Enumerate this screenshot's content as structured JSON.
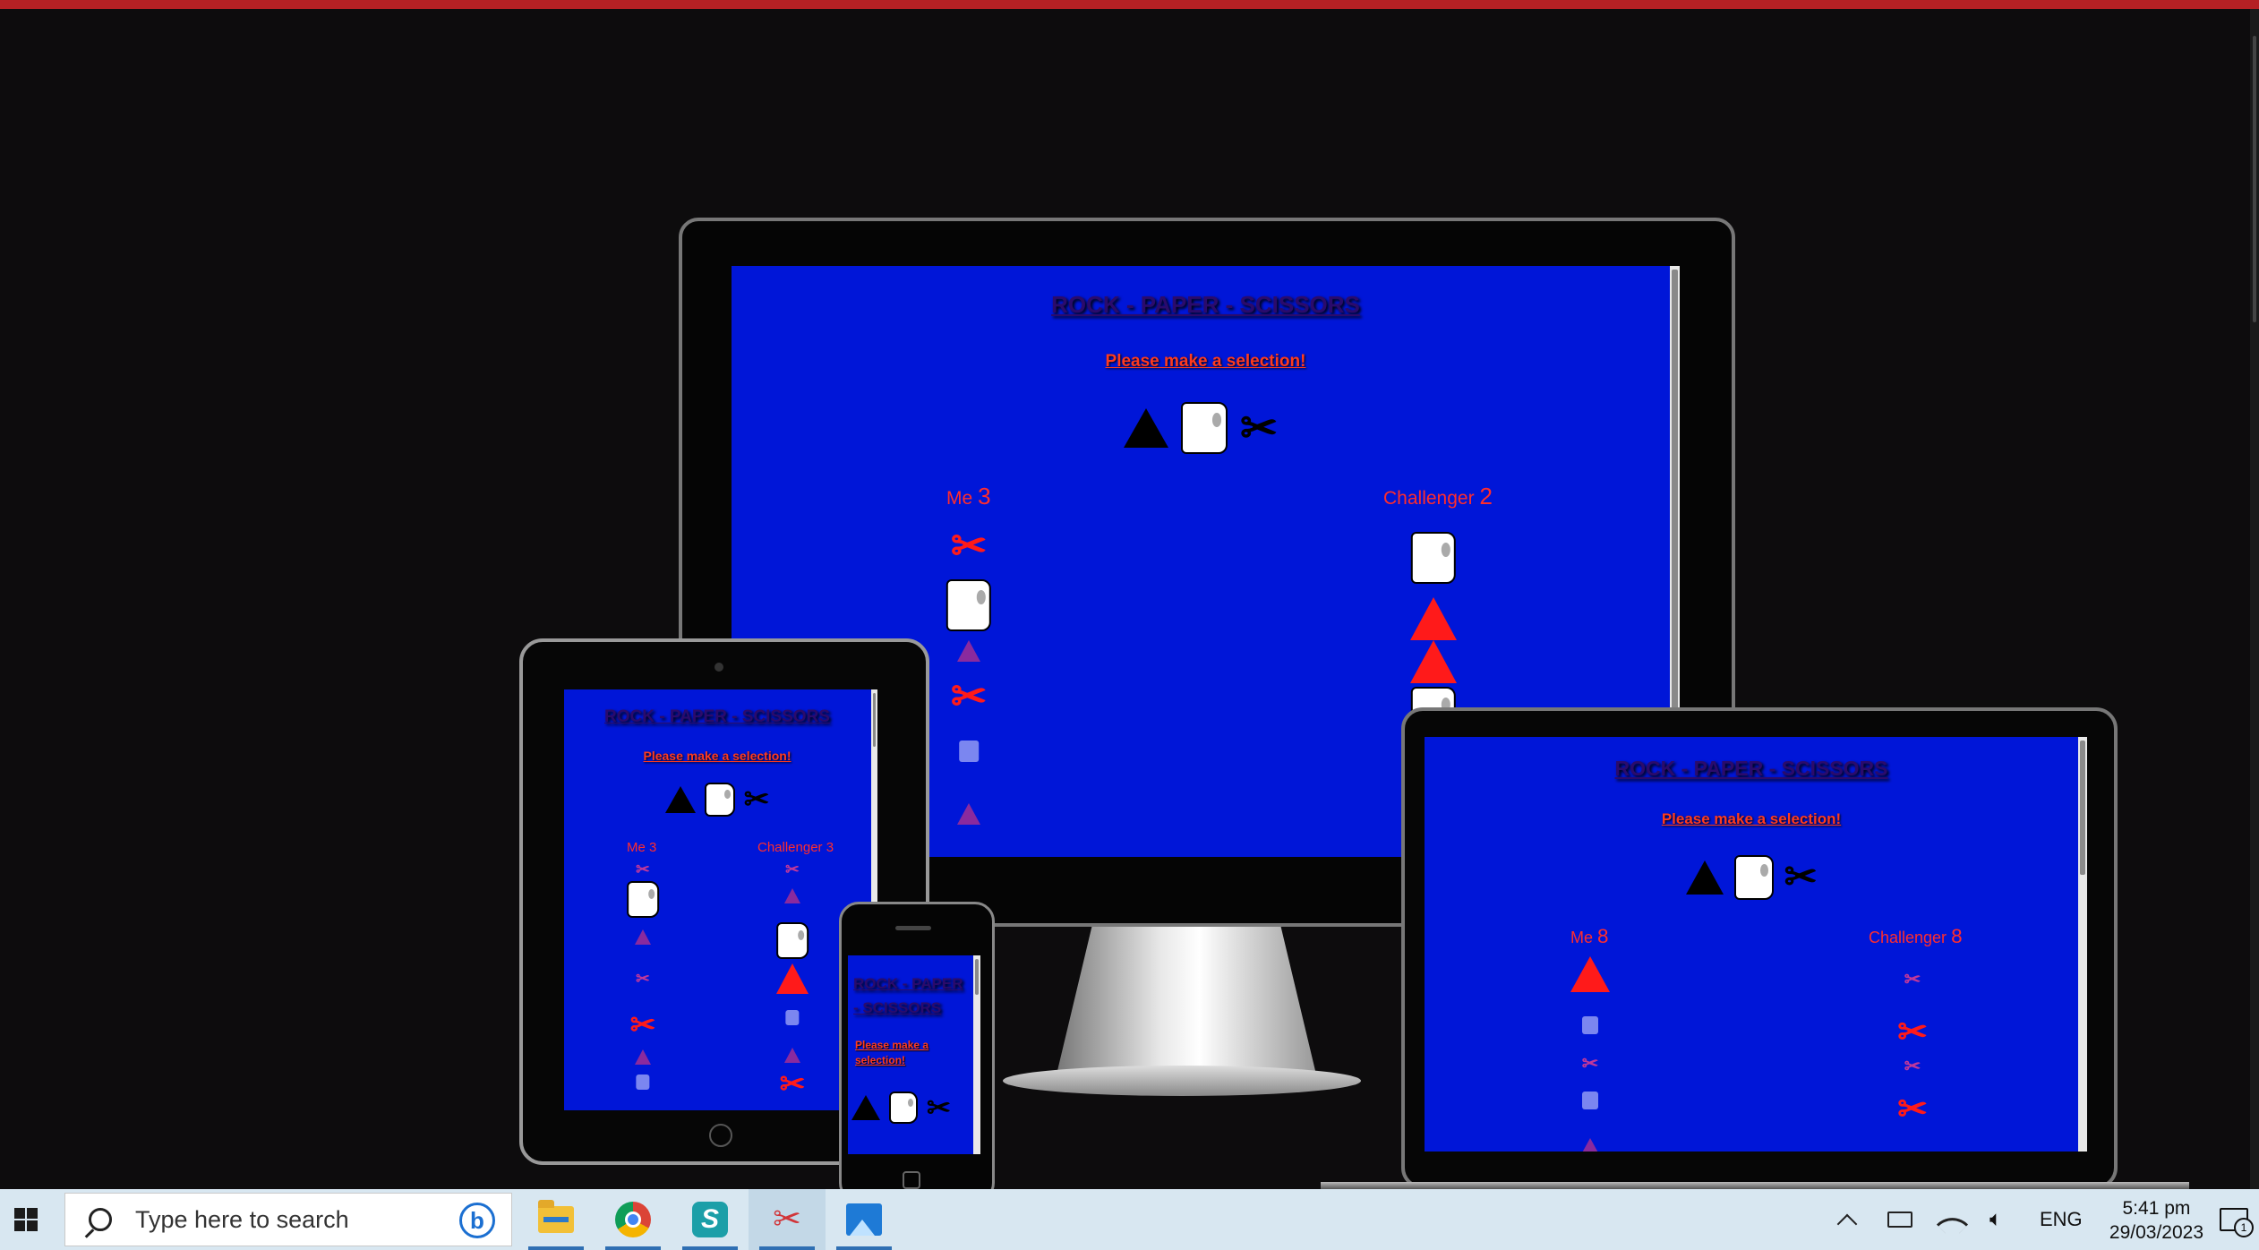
{
  "game": {
    "title": "ROCK - PAPER - SCISSORS",
    "prompt": "Please make a selection!",
    "choice_icons": [
      "rock-icon",
      "paper-icon",
      "scissors-icon"
    ]
  },
  "devices": {
    "desktop": {
      "player_label": "Me",
      "player_score": "3",
      "challenger_label": "Challenger",
      "challenger_score": "2",
      "player_history": [
        "scissors",
        "paper",
        "rock",
        "scissors",
        "paper",
        "rock"
      ],
      "challenger_history": [
        "paper",
        "rock",
        "rock",
        "paper"
      ]
    },
    "tablet": {
      "player_label": "Me",
      "player_score": "3",
      "challenger_label": "Challenger",
      "challenger_score": "3",
      "player_history": [
        "scissors",
        "paper",
        "rock",
        "scissors",
        "scissors",
        "rock",
        "paper"
      ],
      "challenger_history": [
        "scissors",
        "rock",
        "paper",
        "rock",
        "paper",
        "rock",
        "scissors"
      ]
    },
    "phone": {
      "title_line1": "ROCK - PAPER",
      "title_line2": "- SCISSORS",
      "prompt_line1": "Please make a",
      "prompt_line2": "selection!"
    },
    "laptop": {
      "player_label": "Me",
      "player_score": "8",
      "challenger_label": "Challenger",
      "challenger_score": "8",
      "player_history": [
        "rock",
        "paper",
        "scissors",
        "paper",
        "rock"
      ],
      "challenger_history": [
        "scissors",
        "scissors",
        "scissors",
        "scissors"
      ]
    }
  },
  "colors": {
    "screen_bg": "#0016d8",
    "score_red": "#ff2d2d",
    "title_text": "#2b0b6b",
    "top_bar": "#b52024"
  },
  "taskbar": {
    "search_placeholder": "Type here to search",
    "apps": [
      "file-explorer-icon",
      "chrome-icon",
      "s-app-icon",
      "snip-icon",
      "photos-icon"
    ],
    "language": "ENG",
    "time": "5:41 pm",
    "date": "29/03/2023",
    "notification_count": "1"
  }
}
